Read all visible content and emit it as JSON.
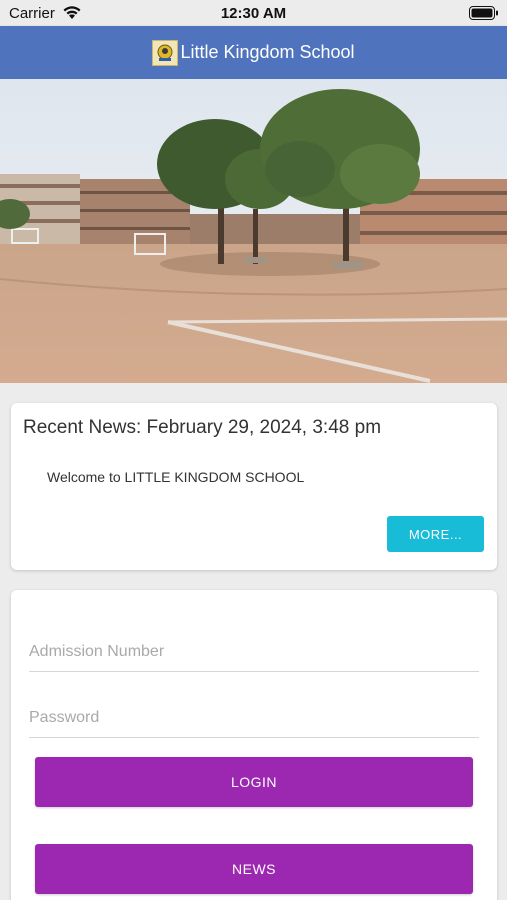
{
  "status_bar": {
    "carrier": "Carrier",
    "time": "12:30 AM",
    "wifi_icon": "wifi-icon",
    "battery_icon": "battery-icon"
  },
  "app_bar": {
    "title": "Little Kingdom School",
    "logo_icon": "school-logo-icon",
    "color": "#4f73bd"
  },
  "hero": {
    "image": "school-campus-photo"
  },
  "news_card": {
    "title": "Recent News: February 29, 2024, 3:48 pm",
    "body": "Welcome to LITTLE KINGDOM SCHOOL",
    "more_label": "MORE..."
  },
  "login_form": {
    "admission_placeholder": "Admission Number",
    "admission_value": "",
    "password_placeholder": "Password",
    "password_value": "",
    "login_label": "LOGIN",
    "news_label": "NEWS"
  },
  "colors": {
    "accent_button": "#9c27b0",
    "more_button": "#18bcd6"
  }
}
